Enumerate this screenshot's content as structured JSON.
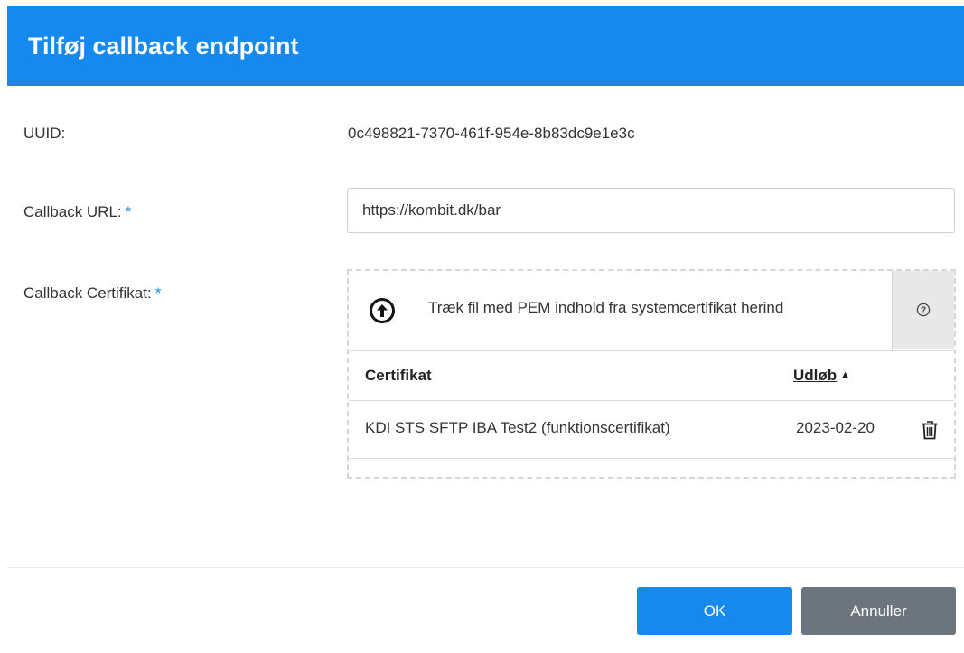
{
  "dialog": {
    "title": "Tilføj callback endpoint"
  },
  "form": {
    "uuid_label": "UUID:",
    "uuid_value": "0c498821-7370-461f-954e-8b83dc9e1e3c",
    "url_label": "Callback URL:",
    "url_value": "https://kombit.dk/bar",
    "cert_label": "Callback Certifikat:",
    "required_marker": "*"
  },
  "certificate": {
    "drop_text": "Træk fil med PEM indhold fra systemcertifikat herind",
    "help_icon": "question-circle-icon",
    "upload_icon": "arrow-up-circle-icon",
    "columns": [
      "Certifikat",
      "Udløb"
    ],
    "sort_indicator": "▲",
    "rows": [
      {
        "name": "KDI STS SFTP IBA Test2 (funktionscertifikat)",
        "expires": "2023-02-20",
        "action_icon": "trash-icon"
      }
    ]
  },
  "buttons": {
    "ok": "OK",
    "cancel": "Annuller"
  },
  "colors": {
    "primary": "#1589ee",
    "secondary": "#6c757d"
  }
}
